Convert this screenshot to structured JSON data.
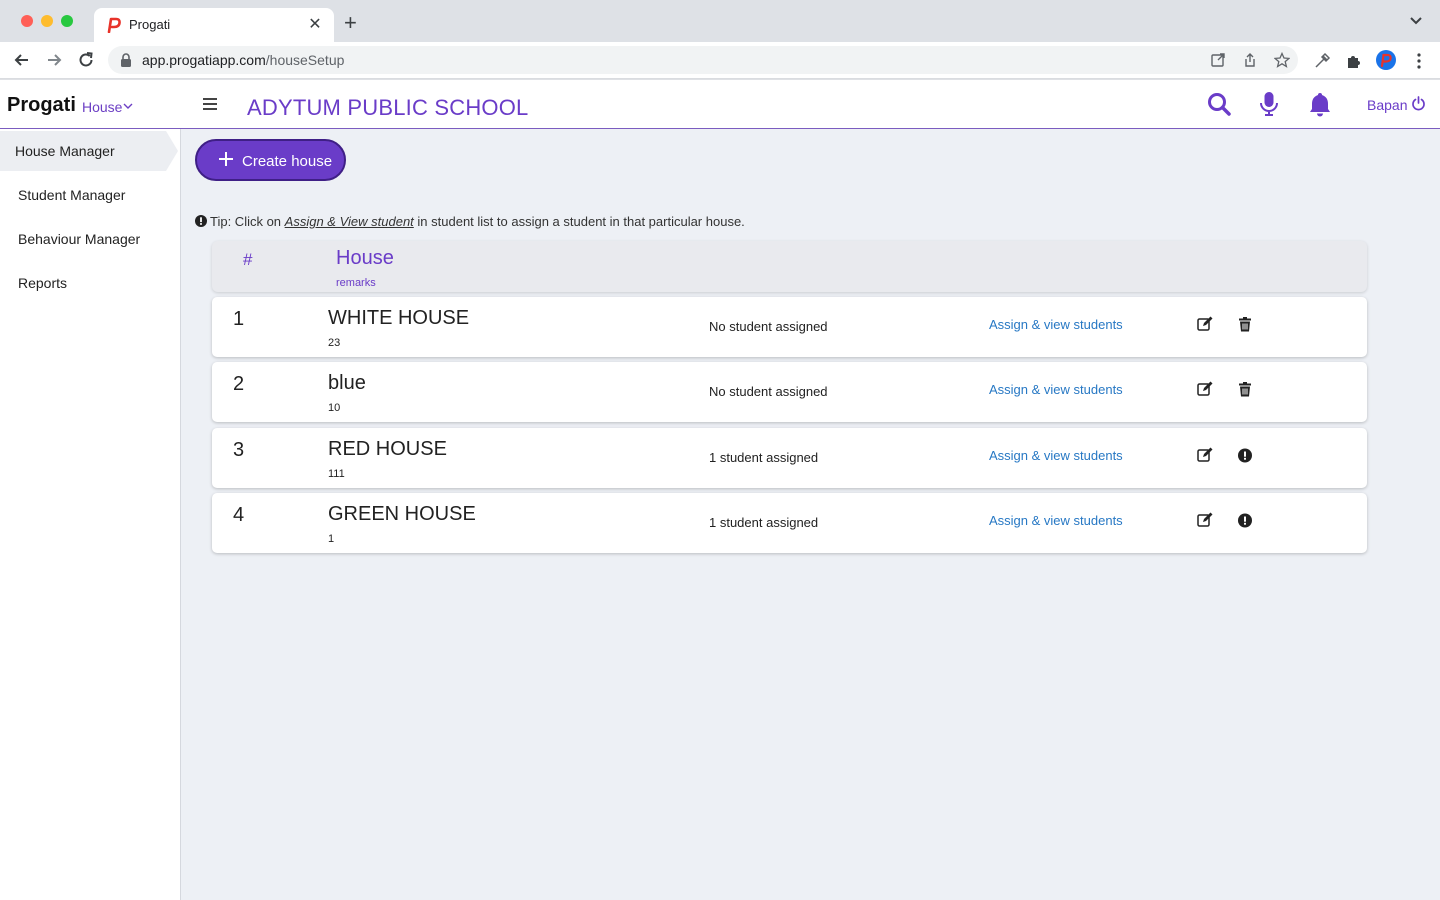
{
  "browser": {
    "tab_title": "Progati",
    "url_host": "app.progatiapp.com",
    "url_path": "/houseSetup"
  },
  "appbar": {
    "brand": "Progati",
    "module": "House",
    "school_name": "ADYTUM PUBLIC SCHOOL",
    "user": "Bapan"
  },
  "sidebar": {
    "items": [
      {
        "label": "House Manager"
      },
      {
        "label": "Student Manager"
      },
      {
        "label": "Behaviour Manager"
      },
      {
        "label": "Reports"
      }
    ]
  },
  "main": {
    "create_button": "Create house",
    "tip": {
      "prefix": "Tip: Click on",
      "link": "Assign & View student",
      "suffix": "in student list to assign a student in that particular house."
    },
    "table": {
      "header": {
        "num": "#",
        "house": "House",
        "remarks": "remarks"
      },
      "rows": [
        {
          "num": "1",
          "name": "WHITE HOUSE",
          "remark": "23",
          "status": "No student assigned",
          "link": "Assign & view students",
          "second_action": "delete"
        },
        {
          "num": "2",
          "name": "blue",
          "remark": "10",
          "status": "No student assigned",
          "link": "Assign & view students",
          "second_action": "delete"
        },
        {
          "num": "3",
          "name": "RED HOUSE",
          "remark": "111",
          "status": "1 student assigned",
          "link": "Assign & view students",
          "second_action": "info"
        },
        {
          "num": "4",
          "name": "GREEN HOUSE",
          "remark": "1",
          "status": "1 student assigned",
          "link": "Assign & view students",
          "second_action": "info"
        }
      ]
    }
  },
  "colors": {
    "accent": "#6a3cc8",
    "link": "#2778c4",
    "background": "#edf0f5"
  }
}
